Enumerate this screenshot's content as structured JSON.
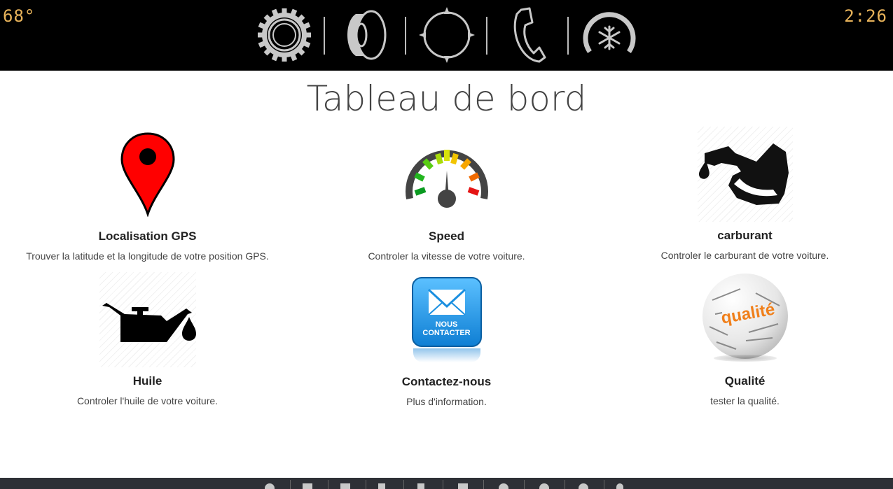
{
  "status": {
    "temperature": "68°",
    "time": "2:26"
  },
  "top_nav": [
    {
      "name": "settings-gear-icon"
    },
    {
      "name": "speaker-icon"
    },
    {
      "name": "navigation-compass-icon"
    },
    {
      "name": "phone-icon"
    },
    {
      "name": "climate-snowflake-icon"
    }
  ],
  "page": {
    "title": "Tableau de bord"
  },
  "cards": [
    {
      "icon": "map-pin-icon",
      "title": "Localisation GPS",
      "description": "Trouver la latitude et la longitude de votre position GPS."
    },
    {
      "icon": "speedometer-icon",
      "title": "Speed",
      "description": "Controler la vitesse de votre voiture."
    },
    {
      "icon": "fuel-pump-icon",
      "title": "carburant",
      "description": "Controler le carburant de votre voiture."
    },
    {
      "icon": "oil-can-icon",
      "title": "Huile",
      "description": "Controler l'huile de votre voiture."
    },
    {
      "icon": "mail-contact-icon",
      "title": "Contactez-nous",
      "description": "Plus d'information.",
      "badge_line1": "NOUS",
      "badge_line2": "CONTACTER"
    },
    {
      "icon": "quality-sphere-icon",
      "title": "Qualité",
      "description": "tester la qualité.",
      "sphere_word": "qualité"
    }
  ],
  "colors": {
    "clock": "#e8b35a",
    "topbar": "#000000",
    "bottombar": "#2e3036",
    "pin": "#ff0000",
    "mail": "#1a8fe0"
  }
}
